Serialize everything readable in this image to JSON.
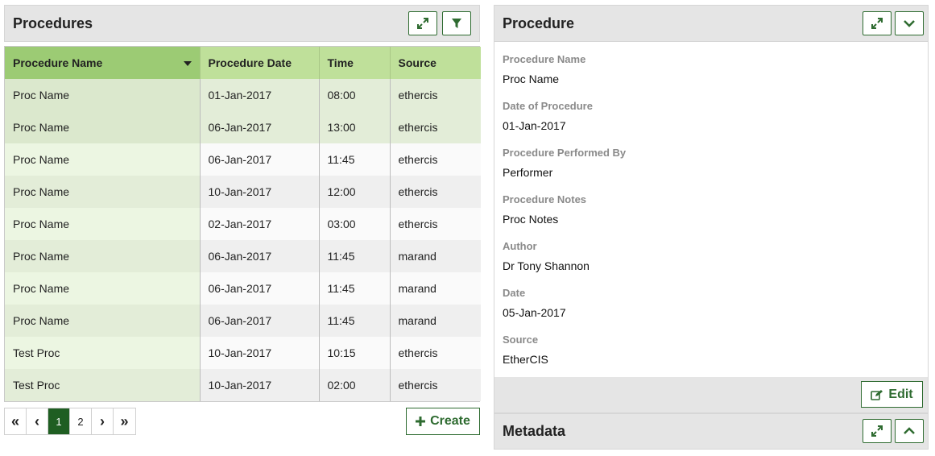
{
  "procedures_panel": {
    "title": "Procedures",
    "columns": [
      "Procedure Name",
      "Procedure Date",
      "Time",
      "Source"
    ],
    "rows": [
      {
        "name": "Proc Name",
        "date": "01-Jan-2017",
        "time": "08:00",
        "source": "ethercis"
      },
      {
        "name": "Proc Name",
        "date": "06-Jan-2017",
        "time": "13:00",
        "source": "ethercis"
      },
      {
        "name": "Proc Name",
        "date": "06-Jan-2017",
        "time": "11:45",
        "source": "ethercis"
      },
      {
        "name": "Proc Name",
        "date": "10-Jan-2017",
        "time": "12:00",
        "source": "ethercis"
      },
      {
        "name": "Proc Name",
        "date": "02-Jan-2017",
        "time": "03:00",
        "source": "ethercis"
      },
      {
        "name": "Proc Name",
        "date": "06-Jan-2017",
        "time": "11:45",
        "source": "marand"
      },
      {
        "name": "Proc Name",
        "date": "06-Jan-2017",
        "time": "11:45",
        "source": "marand"
      },
      {
        "name": "Proc Name",
        "date": "06-Jan-2017",
        "time": "11:45",
        "source": "marand"
      },
      {
        "name": "Test Proc",
        "date": "10-Jan-2017",
        "time": "10:15",
        "source": "ethercis"
      },
      {
        "name": "Test Proc",
        "date": "10-Jan-2017",
        "time": "02:00",
        "source": "ethercis"
      }
    ],
    "pagination": {
      "first": "«",
      "prev": "‹",
      "pages": [
        "1",
        "2"
      ],
      "current": "1",
      "next": "›",
      "last": "»"
    },
    "create_label": "Create"
  },
  "detail_panel": {
    "title": "Procedure",
    "fields": [
      {
        "label": "Procedure Name",
        "value": "Proc Name"
      },
      {
        "label": "Date of Procedure",
        "value": "01-Jan-2017"
      },
      {
        "label": "Procedure Performed By",
        "value": "Performer"
      },
      {
        "label": "Procedure Notes",
        "value": "Proc Notes"
      },
      {
        "label": "Author",
        "value": "Dr Tony Shannon"
      },
      {
        "label": "Date",
        "value": "05-Jan-2017"
      },
      {
        "label": "Source",
        "value": "EtherCIS"
      }
    ],
    "edit_label": "Edit"
  },
  "metadata_panel": {
    "title": "Metadata"
  },
  "icons": {
    "expand": "expand-icon",
    "filter": "filter-icon",
    "collapse": "chevron-down-icon",
    "open": "chevron-up-icon",
    "edit": "edit-icon",
    "plus": "plus-icon"
  },
  "colors": {
    "accent": "#2e6b30",
    "header_green": "#bfe09a",
    "sorted_green": "#9ccb74",
    "active_page": "#1f5e22"
  }
}
